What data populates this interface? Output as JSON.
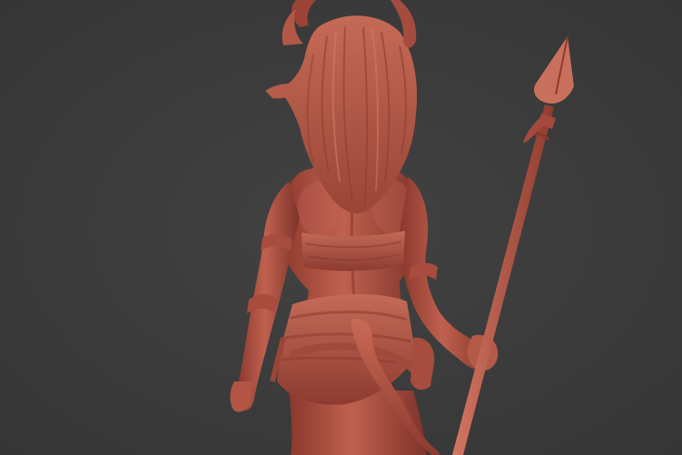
{
  "viewport": {
    "background": "#3b3b3b"
  },
  "model": {
    "subject": "sculpt",
    "material_base": "#b8574a",
    "material_shadow": "#7a3027",
    "material_highlight": "#d9806c"
  }
}
